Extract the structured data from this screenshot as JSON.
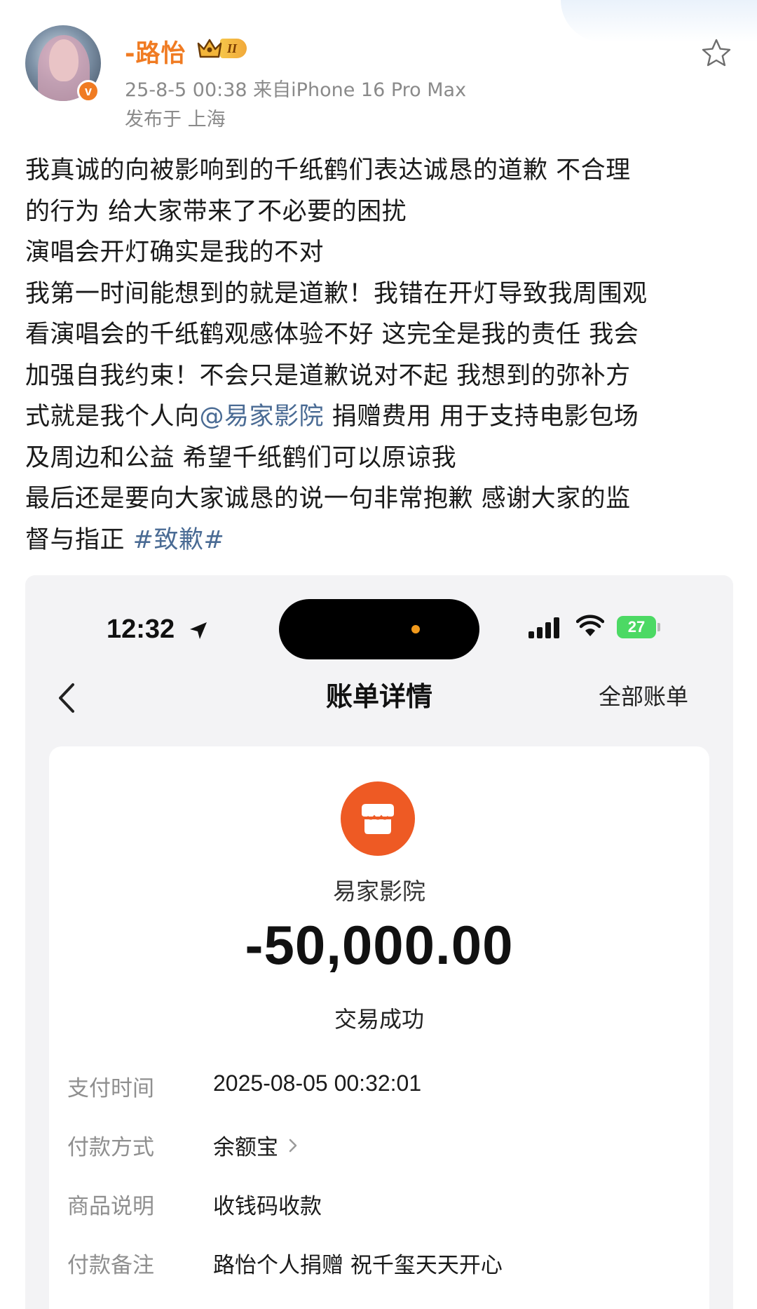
{
  "post": {
    "username": "-路怡",
    "vip_level": "II",
    "verified_mark": "v",
    "meta": "25-8-5 00:38  来自iPhone 16 Pro Max",
    "location": "发布于 上海",
    "body": {
      "line1": "我真诚的向被影响到的千纸鹤们表达诚恳的道歉 不合理",
      "line2": "的行为 给大家带来了不必要的困扰",
      "line3": "演唱会开灯确实是我的不对",
      "line4": "我第一时间能想到的就是道歉！我错在开灯导致我周围观",
      "line5": "看演唱会的千纸鹤观感体验不好 这完全是我的责任  我会",
      "line6": "加强自我约束！不会只是道歉说对不起 我想到的弥补方",
      "line7_pre": "式就是我个人向",
      "line7_mention": "@易家影院",
      "line7_post": " 捐赠费用 用于支持电影包场",
      "line8": "及周边和公益 希望千纸鹤们可以原谅我",
      "line9": "最后还是要向大家诚恳的说一句非常抱歉 感谢大家的监",
      "line10_pre": "督与指正 ",
      "line10_hashtag": "#致歉#"
    }
  },
  "receipt": {
    "status_bar": {
      "time": "12:32",
      "battery": "27"
    },
    "nav": {
      "title": "账单详情",
      "right_link": "全部账单"
    },
    "merchant": "易家影院",
    "amount": "-50,000.00",
    "status": "交易成功",
    "rows": [
      {
        "label": "支付时间",
        "value": "2025-08-05 00:32:01"
      },
      {
        "label": "付款方式",
        "value": "余额宝"
      },
      {
        "label": "商品说明",
        "value": "收钱码收款"
      },
      {
        "label": "付款备注",
        "value": "路怡个人捐赠 祝千玺天天开心"
      }
    ]
  },
  "colors": {
    "username": "#f07b22",
    "link": "#4a6b94",
    "merchant_icon": "#ee5a24",
    "battery": "#4cd964"
  },
  "icons": [
    "star-icon",
    "location-arrow-icon",
    "signal-icon",
    "wifi-icon",
    "battery-icon",
    "back-chevron-icon",
    "store-icon",
    "chevron-right-icon",
    "crown-icon",
    "verified-icon"
  ]
}
